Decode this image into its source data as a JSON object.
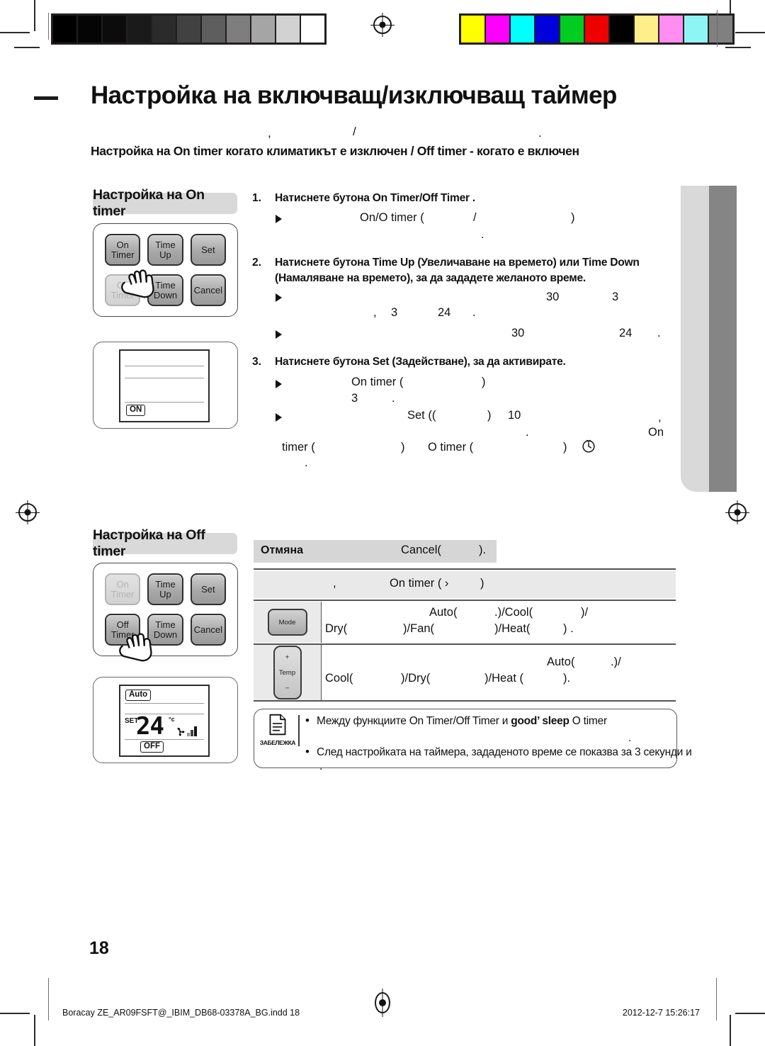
{
  "heading": {
    "title": "Настройка на включващ/изключващ таймер",
    "subtitle": "Настройка на On timer когато климатикът е изключен / Off timer - когато е включен",
    "sub_frag_comma": ",",
    "sub_frag_slash": "/",
    "sub_frag_dot": "."
  },
  "sections": {
    "on_timer_chip": "Настройка на On timer",
    "off_timer_chip": "Настройка на Off timer"
  },
  "keypad": {
    "on_timer": "On\nTimer",
    "time_up": "Time\nUp",
    "set": "Set",
    "off_timer": "Off\nTimer",
    "time_down": "Time\nDown",
    "cancel": "Cancel"
  },
  "lcd_on": {
    "on_tag": "ON"
  },
  "lcd_off": {
    "auto_tag": "Auto",
    "set_label": "SET",
    "value": "24",
    "unit": "°c",
    "off_tag": "OFF"
  },
  "steps": [
    {
      "num": "1.",
      "text": "Натиснете бутона On Timer/Off Timer .",
      "frag_a": "On/O  timer (",
      "frag_slash": "/",
      "frag_paren": ")",
      "frag_dot": "."
    },
    {
      "num": "2.",
      "text_l1": "Натиснете бутона Time Up (Увеличаване на времето) или Time Down",
      "text_l2": "(Намаляване на времето), за да зададете желаното време.",
      "f_30": "30",
      "f_3": "3",
      "f_comma": ",",
      "f_3b": "3",
      "f_24": "24",
      "f_dot": ".",
      "f_30b": "30",
      "f_24b": "24",
      "f_dot2": "."
    },
    {
      "num": "3.",
      "text": "Натиснете бутона Set (Задействане), за да активирате.",
      "f_on_timer": "On timer (",
      "f_paren": ")",
      "f_3": "3",
      "f_dot": ".",
      "f_set": "Set ((",
      "f_paren2": ")",
      "f_10": "10",
      "f_dot2": ".",
      "f_comma": ",",
      "f_on": "On",
      "f_timer": "timer (",
      "f_paren3": ")",
      "f_otimer": "O  timer (",
      "f_paren4": ")",
      "f_dot3": "."
    }
  ],
  "table": {
    "cancel_label": "Отмяна",
    "cancel_text": "Cancel(",
    "cancel_text_end": ").",
    "subhead_comma": ",",
    "subhead_text": "On timer (  ›",
    "subhead_end": ")",
    "rows": [
      {
        "icon": "Mode",
        "l1_a": "Auto(",
        "l1_b": ".)/Cool(",
        "l1_c": ")/",
        "l2_a": "Dry(",
        "l2_b": ")/Fan(",
        "l2_c": ")/Heat(",
        "l2_d": ") ."
      },
      {
        "icon_plus": "+",
        "icon_label": "Temp",
        "icon_minus": "−",
        "l1_a": "Auto(",
        "l1_b": ".)/",
        "l2_a": "Cool(",
        "l2_b": ")/Dry(",
        "l2_c": ")/Heat (",
        "l2_d": ")."
      }
    ]
  },
  "note": {
    "label": "ЗАБЕЛЕЖКА",
    "bullet1_a": "Между функциите On Timer/Off Timer и ",
    "bullet1_b": "good’ sleep",
    "bullet1_c": " O   timer",
    "bullet1_dot": ".",
    "bullet2": "След настройката на таймера, зададеното време се показва за 3 секунди и",
    "bullet2_dot": "."
  },
  "page_number": "18",
  "footer": {
    "left": "Boracay ZE_AR09FSFT@_IBIM_DB68-03378A_BG.indd   18",
    "right": "2012-12-7   15:26:17"
  },
  "gray_bar": [
    "#000000",
    "#050505",
    "#0c0c0c",
    "#1a1a1a",
    "#2b2b2b",
    "#414141",
    "#5e5e5e",
    "#7e7e7e",
    "#a5a5a5",
    "#d2d2d2",
    "#ffffff"
  ],
  "color_bar": [
    "#ffff00",
    "#ff00ff",
    "#00ffff",
    "#0000dd",
    "#00cc22",
    "#ee0000",
    "#000000",
    "#ffef8a",
    "#ff8ef0",
    "#8ef5f5",
    "#808080"
  ]
}
